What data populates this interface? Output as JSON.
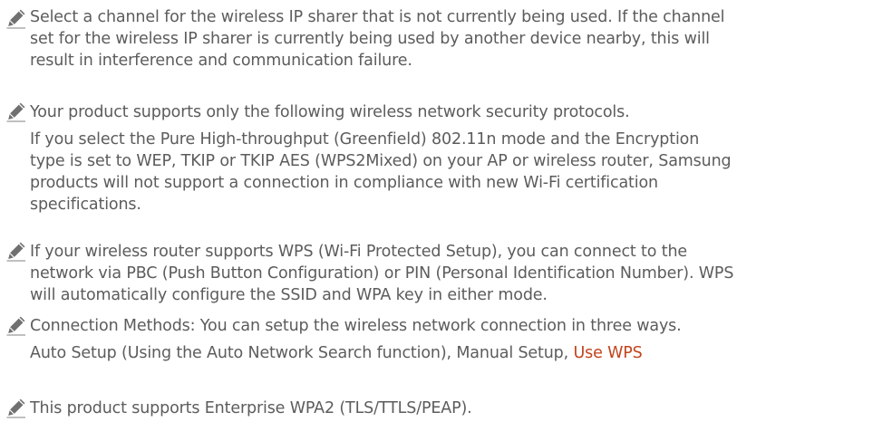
{
  "notes": [
    {
      "icon": "pencil-note-icon",
      "lines": [
        "Select a channel for the wireless IP sharer that is not currently being used. If the channel",
        "set for the wireless IP sharer is currently being used by another device nearby, this will",
        "result in interference and communication failure."
      ]
    },
    {
      "icon": "pencil-note-icon",
      "lines": [
        "Your product supports only the following wireless network security protocols.",
        "If you select the Pure High-throughput (Greenfield) 802.11n mode and the Encryption",
        "type is set to WEP, TKIP or TKIP AES (WPS2Mixed) on your AP or wireless router, Samsung",
        "products will not support a connection in compliance with new Wi-Fi certification",
        "specifications."
      ]
    },
    {
      "icon": "pencil-note-icon",
      "lines": [
        "If your wireless router supports WPS (Wi-Fi Protected Setup), you can connect to the",
        "network via PBC (Push Button Configuration) or PIN (Personal Identification Number). WPS",
        "will automatically configure the SSID and WPA key in either mode."
      ]
    },
    {
      "icon": "pencil-note-icon",
      "lines": [
        "Connection Methods: You can setup the wireless network connection in three ways.",
        "Auto Setup (Using the Auto Network Search function), Manual Setup, "
      ],
      "link_text": "Use WPS"
    },
    {
      "icon": "pencil-note-icon",
      "lines": [
        "This product supports Enterprise WPA2 (TLS/TTLS/PEAP)."
      ]
    }
  ],
  "colors": {
    "text": "#5c5c5c",
    "link": "#c2441c",
    "icon": "#707070"
  }
}
